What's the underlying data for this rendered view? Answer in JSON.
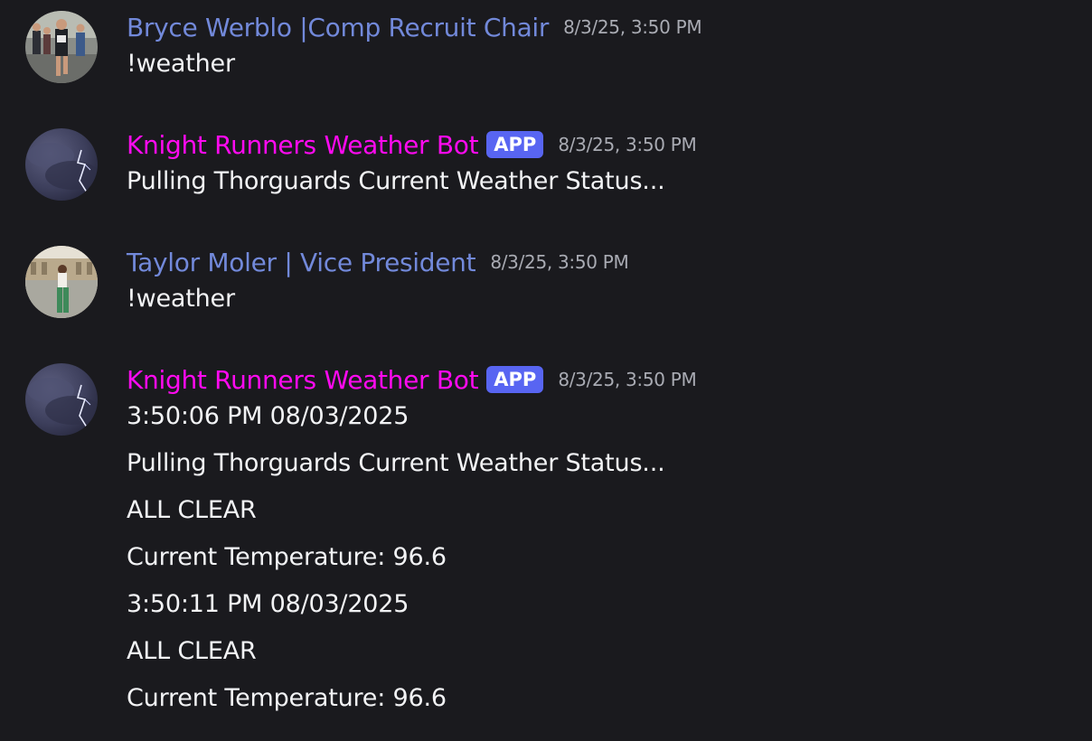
{
  "messages": [
    {
      "username": "Bryce Werblo |Comp Recruit Chair",
      "timestamp": "8/3/25, 3:50 PM",
      "lines": [
        "!weather"
      ]
    },
    {
      "username": "Knight Runners Weather Bot",
      "badge": "APP",
      "timestamp": "8/3/25, 3:50 PM",
      "lines": [
        "Pulling Thorguards Current Weather Status..."
      ]
    },
    {
      "username": "Taylor Moler | Vice President",
      "timestamp": "8/3/25, 3:50 PM",
      "lines": [
        "!weather"
      ]
    },
    {
      "username": "Knight Runners Weather Bot",
      "badge": "APP",
      "timestamp": "8/3/25, 3:50 PM",
      "lines": [
        "3:50:06 PM 08/03/2025",
        "Pulling Thorguards Current Weather Status...",
        "ALL CLEAR",
        "Current Temperature: 96.6",
        "3:50:11 PM 08/03/2025",
        "ALL CLEAR",
        "Current Temperature: 96.6"
      ]
    }
  ],
  "colors": {
    "background": "#1a1a1e",
    "user_name_blue": "#7289da",
    "bot_name_pink": "#ff0af0",
    "app_badge": "#5865f2",
    "timestamp": "#a9abb3",
    "message_text": "#f2f3f5"
  },
  "icons": {
    "avatar_bryce": "runner-photo-avatar",
    "avatar_bot": "storm-lightning-avatar",
    "avatar_taylor": "person-photo-avatar"
  }
}
